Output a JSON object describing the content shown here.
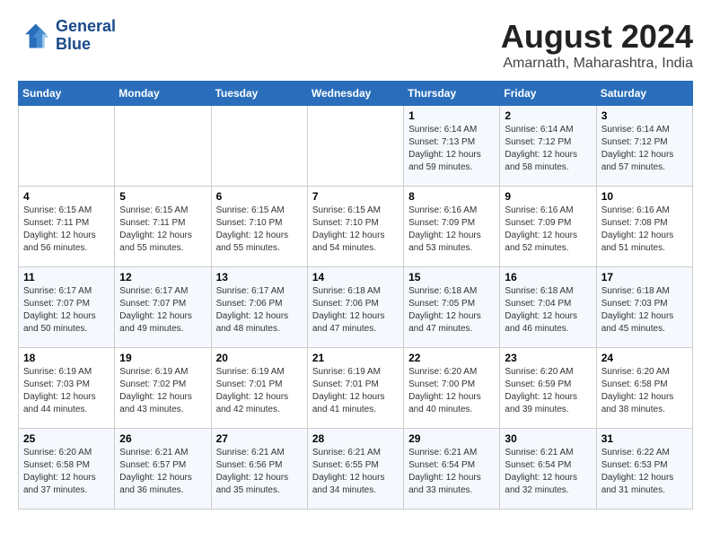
{
  "logo": {
    "text_line1": "General",
    "text_line2": "Blue"
  },
  "title": "August 2024",
  "subtitle": "Amarnath, Maharashtra, India",
  "days_of_week": [
    "Sunday",
    "Monday",
    "Tuesday",
    "Wednesday",
    "Thursday",
    "Friday",
    "Saturday"
  ],
  "weeks": [
    [
      {
        "day": "",
        "sunrise": "",
        "sunset": "",
        "daylight": ""
      },
      {
        "day": "",
        "sunrise": "",
        "sunset": "",
        "daylight": ""
      },
      {
        "day": "",
        "sunrise": "",
        "sunset": "",
        "daylight": ""
      },
      {
        "day": "",
        "sunrise": "",
        "sunset": "",
        "daylight": ""
      },
      {
        "day": "1",
        "sunrise": "Sunrise: 6:14 AM",
        "sunset": "Sunset: 7:13 PM",
        "daylight": "Daylight: 12 hours and 59 minutes."
      },
      {
        "day": "2",
        "sunrise": "Sunrise: 6:14 AM",
        "sunset": "Sunset: 7:12 PM",
        "daylight": "Daylight: 12 hours and 58 minutes."
      },
      {
        "day": "3",
        "sunrise": "Sunrise: 6:14 AM",
        "sunset": "Sunset: 7:12 PM",
        "daylight": "Daylight: 12 hours and 57 minutes."
      }
    ],
    [
      {
        "day": "4",
        "sunrise": "Sunrise: 6:15 AM",
        "sunset": "Sunset: 7:11 PM",
        "daylight": "Daylight: 12 hours and 56 minutes."
      },
      {
        "day": "5",
        "sunrise": "Sunrise: 6:15 AM",
        "sunset": "Sunset: 7:11 PM",
        "daylight": "Daylight: 12 hours and 55 minutes."
      },
      {
        "day": "6",
        "sunrise": "Sunrise: 6:15 AM",
        "sunset": "Sunset: 7:10 PM",
        "daylight": "Daylight: 12 hours and 55 minutes."
      },
      {
        "day": "7",
        "sunrise": "Sunrise: 6:15 AM",
        "sunset": "Sunset: 7:10 PM",
        "daylight": "Daylight: 12 hours and 54 minutes."
      },
      {
        "day": "8",
        "sunrise": "Sunrise: 6:16 AM",
        "sunset": "Sunset: 7:09 PM",
        "daylight": "Daylight: 12 hours and 53 minutes."
      },
      {
        "day": "9",
        "sunrise": "Sunrise: 6:16 AM",
        "sunset": "Sunset: 7:09 PM",
        "daylight": "Daylight: 12 hours and 52 minutes."
      },
      {
        "day": "10",
        "sunrise": "Sunrise: 6:16 AM",
        "sunset": "Sunset: 7:08 PM",
        "daylight": "Daylight: 12 hours and 51 minutes."
      }
    ],
    [
      {
        "day": "11",
        "sunrise": "Sunrise: 6:17 AM",
        "sunset": "Sunset: 7:07 PM",
        "daylight": "Daylight: 12 hours and 50 minutes."
      },
      {
        "day": "12",
        "sunrise": "Sunrise: 6:17 AM",
        "sunset": "Sunset: 7:07 PM",
        "daylight": "Daylight: 12 hours and 49 minutes."
      },
      {
        "day": "13",
        "sunrise": "Sunrise: 6:17 AM",
        "sunset": "Sunset: 7:06 PM",
        "daylight": "Daylight: 12 hours and 48 minutes."
      },
      {
        "day": "14",
        "sunrise": "Sunrise: 6:18 AM",
        "sunset": "Sunset: 7:06 PM",
        "daylight": "Daylight: 12 hours and 47 minutes."
      },
      {
        "day": "15",
        "sunrise": "Sunrise: 6:18 AM",
        "sunset": "Sunset: 7:05 PM",
        "daylight": "Daylight: 12 hours and 47 minutes."
      },
      {
        "day": "16",
        "sunrise": "Sunrise: 6:18 AM",
        "sunset": "Sunset: 7:04 PM",
        "daylight": "Daylight: 12 hours and 46 minutes."
      },
      {
        "day": "17",
        "sunrise": "Sunrise: 6:18 AM",
        "sunset": "Sunset: 7:03 PM",
        "daylight": "Daylight: 12 hours and 45 minutes."
      }
    ],
    [
      {
        "day": "18",
        "sunrise": "Sunrise: 6:19 AM",
        "sunset": "Sunset: 7:03 PM",
        "daylight": "Daylight: 12 hours and 44 minutes."
      },
      {
        "day": "19",
        "sunrise": "Sunrise: 6:19 AM",
        "sunset": "Sunset: 7:02 PM",
        "daylight": "Daylight: 12 hours and 43 minutes."
      },
      {
        "day": "20",
        "sunrise": "Sunrise: 6:19 AM",
        "sunset": "Sunset: 7:01 PM",
        "daylight": "Daylight: 12 hours and 42 minutes."
      },
      {
        "day": "21",
        "sunrise": "Sunrise: 6:19 AM",
        "sunset": "Sunset: 7:01 PM",
        "daylight": "Daylight: 12 hours and 41 minutes."
      },
      {
        "day": "22",
        "sunrise": "Sunrise: 6:20 AM",
        "sunset": "Sunset: 7:00 PM",
        "daylight": "Daylight: 12 hours and 40 minutes."
      },
      {
        "day": "23",
        "sunrise": "Sunrise: 6:20 AM",
        "sunset": "Sunset: 6:59 PM",
        "daylight": "Daylight: 12 hours and 39 minutes."
      },
      {
        "day": "24",
        "sunrise": "Sunrise: 6:20 AM",
        "sunset": "Sunset: 6:58 PM",
        "daylight": "Daylight: 12 hours and 38 minutes."
      }
    ],
    [
      {
        "day": "25",
        "sunrise": "Sunrise: 6:20 AM",
        "sunset": "Sunset: 6:58 PM",
        "daylight": "Daylight: 12 hours and 37 minutes."
      },
      {
        "day": "26",
        "sunrise": "Sunrise: 6:21 AM",
        "sunset": "Sunset: 6:57 PM",
        "daylight": "Daylight: 12 hours and 36 minutes."
      },
      {
        "day": "27",
        "sunrise": "Sunrise: 6:21 AM",
        "sunset": "Sunset: 6:56 PM",
        "daylight": "Daylight: 12 hours and 35 minutes."
      },
      {
        "day": "28",
        "sunrise": "Sunrise: 6:21 AM",
        "sunset": "Sunset: 6:55 PM",
        "daylight": "Daylight: 12 hours and 34 minutes."
      },
      {
        "day": "29",
        "sunrise": "Sunrise: 6:21 AM",
        "sunset": "Sunset: 6:54 PM",
        "daylight": "Daylight: 12 hours and 33 minutes."
      },
      {
        "day": "30",
        "sunrise": "Sunrise: 6:21 AM",
        "sunset": "Sunset: 6:54 PM",
        "daylight": "Daylight: 12 hours and 32 minutes."
      },
      {
        "day": "31",
        "sunrise": "Sunrise: 6:22 AM",
        "sunset": "Sunset: 6:53 PM",
        "daylight": "Daylight: 12 hours and 31 minutes."
      }
    ]
  ]
}
